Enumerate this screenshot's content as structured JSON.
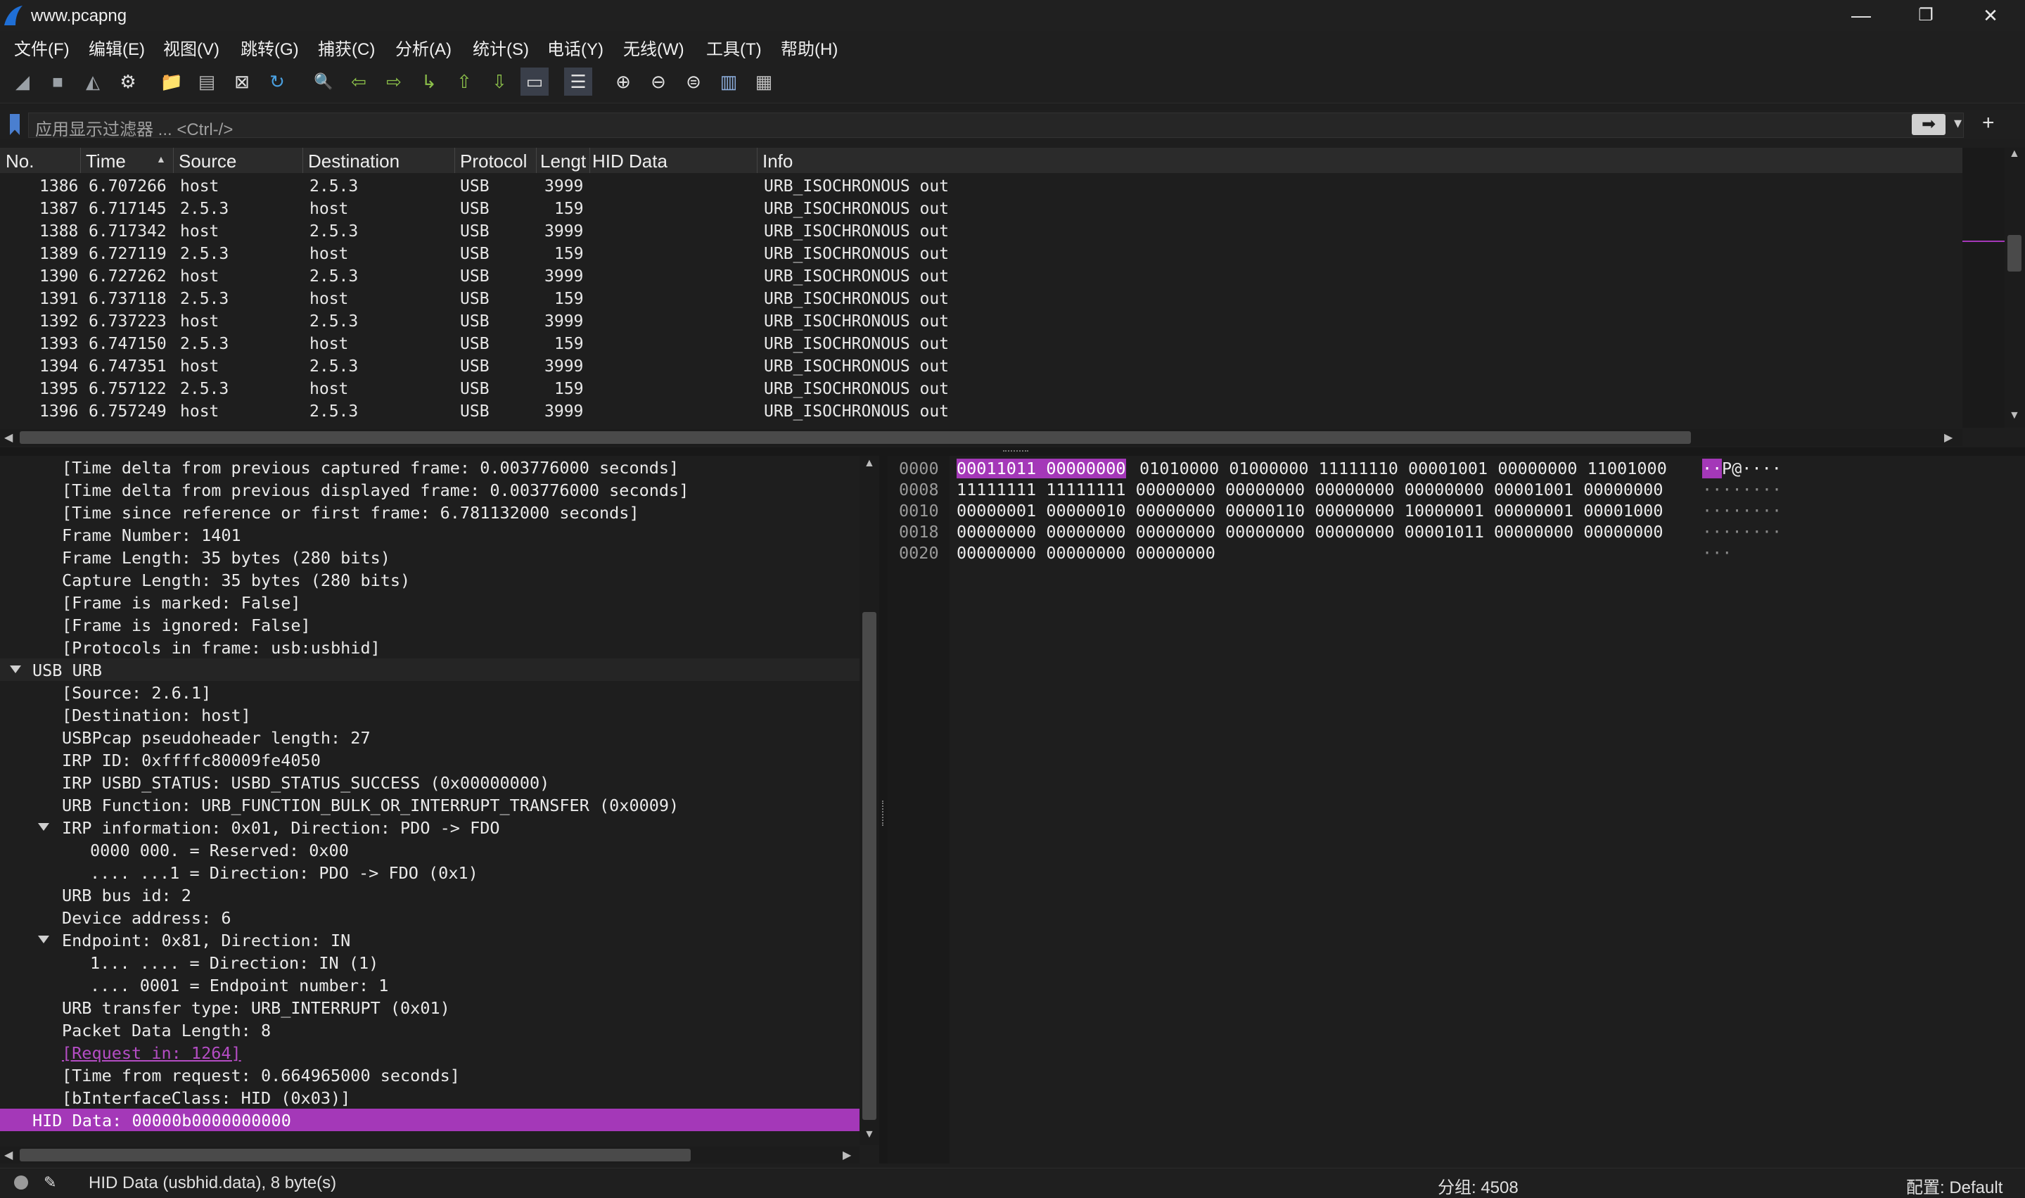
{
  "window": {
    "title": "www.pcapng",
    "minimize": "—",
    "maximize": "❐",
    "close": "✕"
  },
  "menu": [
    "文件(F)",
    "编辑(E)",
    "视图(V)",
    "跳转(G)",
    "捕获(C)",
    "分析(A)",
    "统计(S)",
    "电话(Y)",
    "无线(W)",
    "工具(T)",
    "帮助(H)"
  ],
  "toolbar": {
    "icons": [
      "shark-fin-start-icon",
      "stop-square-icon",
      "shark-fin-restart-icon",
      "gear-options-icon",
      "folder-open-icon",
      "file-icon",
      "close-file-icon",
      "reload-icon",
      "find-magnifier-icon",
      "arrow-left-icon",
      "arrow-right-icon",
      "goto-packet-icon",
      "arrow-up-first-icon",
      "arrow-down-last-icon",
      "autoscroll-icon",
      "colorize-icon",
      "zoom-in-icon",
      "zoom-out-icon",
      "zoom-normal-icon",
      "resize-columns-icon",
      "layout-grid-icon"
    ],
    "glyphs": [
      "◢",
      "■",
      "◭",
      "⚙",
      "📁",
      "▤",
      "⊠",
      "↻",
      "🔍",
      "⇦",
      "⇨",
      "↳",
      "⇧",
      "⇩",
      "▭",
      "☰",
      "⊕",
      "⊖",
      "⊜",
      "▥",
      "▦"
    ]
  },
  "filter": {
    "placeholder": "应用显示过滤器 ... <Ctrl-/>",
    "apply_glyph": "➡",
    "dropdown_glyph": "▾",
    "add_glyph": "+"
  },
  "packet_list": {
    "columns": [
      "No.",
      "Time",
      "Source",
      "Destination",
      "Protocol",
      "Lengt",
      "HID Data",
      "Info"
    ],
    "sort_indicator": "▲",
    "rows": [
      {
        "no": "1386",
        "time": "6.707266",
        "src": "host",
        "dst": "2.5.3",
        "proto": "USB",
        "len": "3999",
        "info": "URB_ISOCHRONOUS out"
      },
      {
        "no": "1387",
        "time": "6.717145",
        "src": "2.5.3",
        "dst": "host",
        "proto": "USB",
        "len": "159",
        "info": "URB_ISOCHRONOUS out"
      },
      {
        "no": "1388",
        "time": "6.717342",
        "src": "host",
        "dst": "2.5.3",
        "proto": "USB",
        "len": "3999",
        "info": "URB_ISOCHRONOUS out"
      },
      {
        "no": "1389",
        "time": "6.727119",
        "src": "2.5.3",
        "dst": "host",
        "proto": "USB",
        "len": "159",
        "info": "URB_ISOCHRONOUS out"
      },
      {
        "no": "1390",
        "time": "6.727262",
        "src": "host",
        "dst": "2.5.3",
        "proto": "USB",
        "len": "3999",
        "info": "URB_ISOCHRONOUS out"
      },
      {
        "no": "1391",
        "time": "6.737118",
        "src": "2.5.3",
        "dst": "host",
        "proto": "USB",
        "len": "159",
        "info": "URB_ISOCHRONOUS out"
      },
      {
        "no": "1392",
        "time": "6.737223",
        "src": "host",
        "dst": "2.5.3",
        "proto": "USB",
        "len": "3999",
        "info": "URB_ISOCHRONOUS out"
      },
      {
        "no": "1393",
        "time": "6.747150",
        "src": "2.5.3",
        "dst": "host",
        "proto": "USB",
        "len": "159",
        "info": "URB_ISOCHRONOUS out"
      },
      {
        "no": "1394",
        "time": "6.747351",
        "src": "host",
        "dst": "2.5.3",
        "proto": "USB",
        "len": "3999",
        "info": "URB_ISOCHRONOUS out"
      },
      {
        "no": "1395",
        "time": "6.757122",
        "src": "2.5.3",
        "dst": "host",
        "proto": "USB",
        "len": "159",
        "info": "URB_ISOCHRONOUS out"
      },
      {
        "no": "1396",
        "time": "6.757249",
        "src": "host",
        "dst": "2.5.3",
        "proto": "USB",
        "len": "3999",
        "info": "URB_ISOCHRONOUS out"
      }
    ]
  },
  "details": [
    {
      "text": "[Time delta from previous captured frame: 0.003776000 seconds]",
      "level": 2
    },
    {
      "text": "[Time delta from previous displayed frame: 0.003776000 seconds]",
      "level": 2
    },
    {
      "text": "[Time since reference or first frame: 6.781132000 seconds]",
      "level": 2
    },
    {
      "text": "Frame Number: 1401",
      "level": 2
    },
    {
      "text": "Frame Length: 35 bytes (280 bits)",
      "level": 2
    },
    {
      "text": "Capture Length: 35 bytes (280 bits)",
      "level": 2
    },
    {
      "text": "[Frame is marked: False]",
      "level": 2
    },
    {
      "text": "[Frame is ignored: False]",
      "level": 2
    },
    {
      "text": "[Protocols in frame: usb:usbhid]",
      "level": 2
    },
    {
      "text": "USB URB",
      "level": 1,
      "expanded": true,
      "header": true
    },
    {
      "text": "[Source: 2.6.1]",
      "level": 2
    },
    {
      "text": "[Destination: host]",
      "level": 2
    },
    {
      "text": "USBPcap pseudoheader length: 27",
      "level": 2
    },
    {
      "text": "IRP ID: 0xffffc80009fe4050",
      "level": 2
    },
    {
      "text": "IRP USBD_STATUS: USBD_STATUS_SUCCESS (0x00000000)",
      "level": 2
    },
    {
      "text": "URB Function: URB_FUNCTION_BULK_OR_INTERRUPT_TRANSFER (0x0009)",
      "level": 2
    },
    {
      "text": "IRP information: 0x01, Direction: PDO -> FDO",
      "level": 2,
      "expanded": true
    },
    {
      "text": "0000 000. = Reserved: 0x00",
      "level": 3
    },
    {
      "text": ".... ...1 = Direction: PDO -> FDO (0x1)",
      "level": 3
    },
    {
      "text": "URB bus id: 2",
      "level": 2
    },
    {
      "text": "Device address: 6",
      "level": 2
    },
    {
      "text": "Endpoint: 0x81, Direction: IN",
      "level": 2,
      "expanded": true
    },
    {
      "text": "1... .... = Direction: IN (1)",
      "level": 3
    },
    {
      "text": ".... 0001 = Endpoint number: 1",
      "level": 3
    },
    {
      "text": "URB transfer type: URB_INTERRUPT (0x01)",
      "level": 2
    },
    {
      "text": "Packet Data Length: 8",
      "level": 2
    },
    {
      "text": "[Request in: 1264]",
      "level": 2,
      "link": true
    },
    {
      "text": "[Time from request: 0.664965000 seconds]",
      "level": 2
    },
    {
      "text": "[bInterfaceClass: HID (0x03)]",
      "level": 2
    },
    {
      "text": "HID Data: 00000b0000000000",
      "level": 1,
      "selected": true
    }
  ],
  "bytes": [
    {
      "offset": "0000",
      "hl": "00011011 00000000",
      "bits": "01010000 01000000 11111110 00001001 00000000 11001000",
      "ascii_hl": "··",
      "ascii": "P@····"
    },
    {
      "offset": "0008",
      "hl": "",
      "bits": "11111111 11111111 00000000 00000000 00000000 00000000 00001001 00000000",
      "ascii_hl": "",
      "ascii": "········"
    },
    {
      "offset": "0010",
      "hl": "",
      "bits": "00000001 00000010 00000000 00000110 00000000 10000001 00000001 00001000",
      "ascii_hl": "",
      "ascii": "········"
    },
    {
      "offset": "0018",
      "hl": "",
      "bits": "00000000 00000000 00000000 00000000 00000000 00001011 00000000 00000000",
      "ascii_hl": "",
      "ascii": "········"
    },
    {
      "offset": "0020",
      "hl": "",
      "bits": "00000000 00000000 00000000",
      "ascii_hl": "",
      "ascii": "···"
    }
  ],
  "status": {
    "field_info": "HID Data (usbhid.data), 8 byte(s)",
    "packets": "分组: 4508",
    "profile": "配置: Default"
  },
  "colors": {
    "selection": "#a438b8",
    "link": "#b44dc4",
    "background": "#1e1e1e"
  }
}
